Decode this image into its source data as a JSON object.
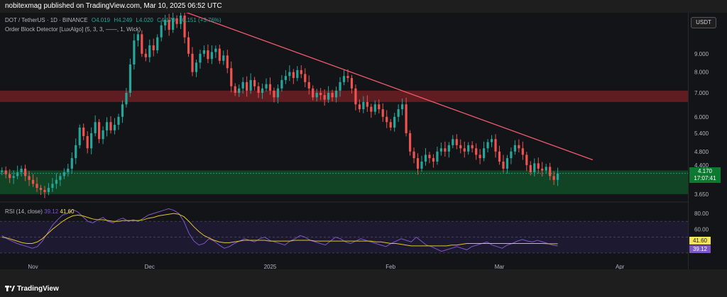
{
  "header": {
    "publish_text": "nobitexmag published on TradingView.com, Mar 10, 2025 06:52 UTC"
  },
  "legend": {
    "symbol": "DOT / TetherUS · 1D · BINANCE",
    "open": "O4.019",
    "high": "H4.249",
    "low": "L4.020",
    "close": "C4.170",
    "change": "+0.151 (+3.76%)",
    "indicator": "Order Block Detector [LuxAlgo] (5, 3, 3, ——, 1, Wick)"
  },
  "currency_button": "USDT",
  "price_tag": {
    "price": "4.170",
    "countdown": "17:07:41"
  },
  "rsi": {
    "label": "RSI (14, close)",
    "value": "39.12",
    "ma_value": "41.60",
    "tag_ma": "41.60",
    "tag_rsi": "39.12"
  },
  "footer": {
    "brand": "TradingView"
  },
  "colors": {
    "up": "#26a69a",
    "down": "#ef5350",
    "trendline": "#f05a6e",
    "order_block_bull": "#0f6b2f",
    "order_block_bear": "#7a1f25",
    "rsi_line": "#7e57c2",
    "rsi_ma": "#e0c52b"
  },
  "chart_data": [
    {
      "type": "candlestick",
      "title": "",
      "y_scale": "log",
      "ylim": [
        3.55,
        11.5
      ],
      "y_ticks": [
        "9.000",
        "8.000",
        "7.000",
        "6.000",
        "5.400",
        "4.800",
        "4.400",
        "3.650"
      ],
      "x_ticks": [
        "Nov",
        "Dec",
        "2025",
        "Feb",
        "Mar",
        "Apr"
      ],
      "x_range": [
        "2024-10-24",
        "2025-04-19"
      ],
      "closes_approx": [
        4.25,
        4.15,
        4.05,
        4.1,
        4.2,
        4.3,
        4.1,
        4.0,
        3.9,
        3.8,
        3.75,
        3.7,
        3.8,
        3.9,
        4.0,
        4.1,
        4.2,
        4.3,
        4.6,
        5.0,
        5.6,
        5.3,
        4.9,
        5.4,
        5.8,
        5.2,
        5.5,
        5.8,
        5.5,
        5.7,
        6.0,
        6.5,
        7.0,
        8.4,
        9.8,
        10.2,
        9.0,
        8.8,
        9.5,
        9.2,
        10.0,
        10.8,
        11.2,
        10.5,
        11.3,
        10.9,
        11.5,
        10.0,
        9.0,
        8.0,
        8.5,
        9.0,
        9.2,
        8.7,
        9.1,
        9.3,
        8.6,
        8.9,
        8.2,
        7.3,
        7.0,
        7.2,
        7.5,
        7.1,
        7.6,
        7.3,
        7.0,
        7.2,
        7.4,
        7.1,
        6.8,
        7.2,
        7.6,
        7.8,
        8.0,
        7.7,
        8.1,
        7.9,
        7.5,
        7.2,
        6.8,
        7.0,
        6.9,
        6.7,
        7.0,
        6.8,
        7.1,
        7.5,
        7.8,
        7.7,
        7.2,
        6.5,
        6.3,
        6.6,
        6.4,
        6.2,
        6.5,
        6.3,
        6.0,
        5.8,
        5.6,
        6.0,
        6.3,
        6.5,
        5.4,
        4.8,
        4.6,
        4.3,
        4.5,
        4.7,
        4.6,
        4.5,
        4.8,
        4.9,
        4.8,
        5.0,
        5.2,
        5.0,
        4.9,
        4.8,
        5.0,
        4.9,
        4.7,
        4.6,
        4.9,
        5.1,
        5.2,
        4.8,
        4.5,
        4.3,
        4.6,
        4.8,
        5.0,
        4.9,
        4.7,
        4.4,
        4.2,
        4.45,
        4.3,
        4.25,
        4.35,
        4.1,
        4.0,
        4.17
      ],
      "order_blocks": [
        {
          "kind": "bearish",
          "top": 7.1,
          "bottom": 6.6
        },
        {
          "kind": "bullish",
          "top": 4.25,
          "bottom": 3.65
        }
      ],
      "trendline": {
        "from": {
          "x": "2024-12-08",
          "y": 12.0
        },
        "to": {
          "x": "2025-03-25",
          "y": 4.55
        }
      },
      "last_price": 4.17
    },
    {
      "type": "line",
      "title": "",
      "ylim": [
        20,
        90
      ],
      "y_ticks": [
        "80.00",
        "60.00"
      ],
      "series": [
        {
          "values": [
            52,
            48,
            45,
            42,
            40,
            38,
            36,
            38,
            45,
            55,
            65,
            72,
            78,
            80,
            85,
            82,
            76,
            70,
            68,
            72,
            75,
            70,
            68,
            72,
            74,
            70,
            72,
            70,
            74,
            78,
            80,
            82,
            84,
            86,
            84,
            80,
            70,
            55,
            45,
            40,
            42,
            48,
            45,
            40,
            36,
            38,
            42,
            45,
            48,
            46,
            44,
            48,
            50,
            46,
            44,
            42,
            40,
            45,
            48,
            52,
            50,
            46,
            44,
            42,
            40,
            45,
            50,
            48,
            44,
            42,
            45,
            48,
            46,
            44,
            42,
            40,
            38,
            42,
            45,
            48,
            46,
            44,
            50,
            45,
            40,
            38,
            35,
            32,
            34,
            36,
            38,
            36,
            34,
            38,
            40,
            42,
            44,
            40,
            38,
            36,
            40,
            42,
            45,
            47,
            45,
            44,
            46,
            44,
            42,
            40,
            39
          ]
        },
        {
          "values": [
            50,
            49,
            47,
            45,
            43,
            42,
            42,
            44,
            48,
            54,
            60,
            65,
            70,
            74,
            77,
            78,
            77,
            75,
            73,
            72,
            72,
            71,
            70,
            70,
            71,
            71,
            71,
            71,
            72,
            74,
            75,
            77,
            78,
            79,
            80,
            79,
            76,
            70,
            63,
            57,
            52,
            49,
            46,
            44,
            43,
            43,
            44,
            45,
            46,
            46,
            46,
            46,
            46,
            45,
            45,
            45,
            45,
            45,
            46,
            46,
            46,
            46,
            45,
            45,
            45,
            45,
            45,
            45,
            45,
            45,
            45,
            45,
            45,
            45,
            44,
            44,
            43,
            42,
            42,
            41,
            40,
            39,
            39,
            39,
            39,
            39,
            39,
            39,
            39,
            40,
            40,
            41,
            42,
            42,
            42,
            42,
            42,
            42,
            42,
            42,
            42,
            42,
            42,
            42,
            42,
            42,
            42,
            42,
            41.6,
            41.6,
            41.6
          ]
        }
      ],
      "level_lines": [
        70,
        50,
        30
      ]
    }
  ]
}
